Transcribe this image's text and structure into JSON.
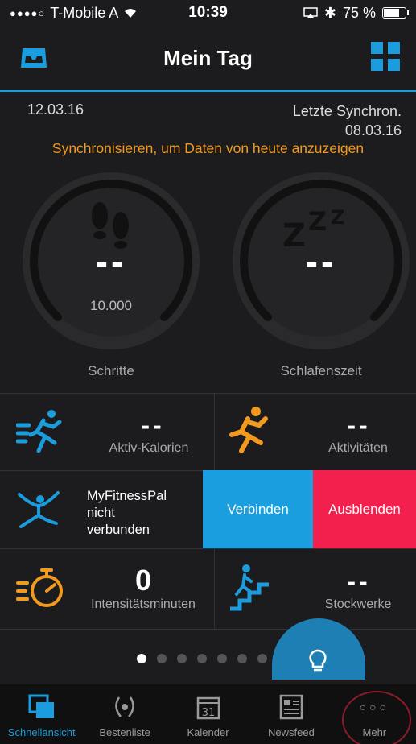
{
  "status": {
    "carrier": "T-Mobile A",
    "time": "10:39",
    "battery": "75 %",
    "battery_level": 0.75
  },
  "header": {
    "title": "Mein Tag"
  },
  "sync": {
    "date": "12.03.16",
    "last_sync_label": "Letzte Synchron.",
    "last_sync_date": "08.03.16",
    "warning": "Synchronisieren, um Daten von heute anzuzeigen"
  },
  "gauges": {
    "steps": {
      "value": "--",
      "goal": "10.000",
      "label": "Schritte",
      "icon": "footprints-icon"
    },
    "sleep": {
      "value": "--",
      "label": "Schlafenszeit",
      "icon": "sleep-zzz-icon"
    }
  },
  "tiles": {
    "active_calories": {
      "value": "--",
      "label": "Aktiv-Kalorien",
      "icon": "running-man-blue-icon"
    },
    "activities": {
      "value": "--",
      "label": "Aktivitäten",
      "icon": "running-man-orange-icon"
    },
    "intensity": {
      "value": "0",
      "label": "Intensitätsminuten",
      "icon": "stopwatch-icon"
    },
    "floors": {
      "value": "--",
      "label": "Stockwerke",
      "icon": "stairs-icon"
    }
  },
  "mfp": {
    "line1": "MyFitnessPal",
    "line2": "nicht",
    "line3": "verbunden",
    "connect_label": "Verbinden",
    "hide_label": "Ausblenden"
  },
  "pager": {
    "count": 7,
    "active": 1
  },
  "tabs": [
    {
      "label": "Schnellansicht",
      "icon": "quickview-icon",
      "active": true
    },
    {
      "label": "Bestenliste",
      "icon": "laurel-icon",
      "active": false
    },
    {
      "label": "Kalender",
      "icon": "calendar-icon",
      "day": "31",
      "active": false
    },
    {
      "label": "Newsfeed",
      "icon": "newspaper-icon",
      "active": false
    },
    {
      "label": "Mehr",
      "icon": "more-dots-icon",
      "active": false
    }
  ],
  "colors": {
    "accent": "#1b9cdd",
    "warning": "#f19a1f",
    "hide": "#f31f4c",
    "connect": "#1a9ee0"
  }
}
